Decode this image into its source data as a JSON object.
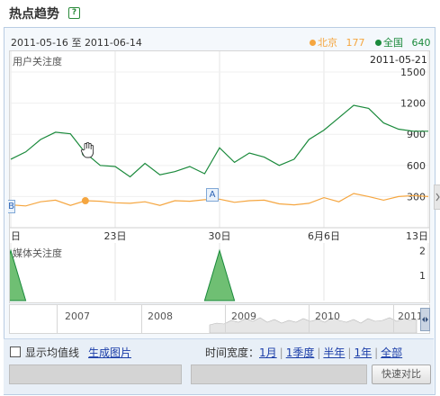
{
  "header": {
    "title": "热点趋势",
    "help_label": "?"
  },
  "range": {
    "start": "2011-05-16",
    "to": "至",
    "end": "2011-06-14"
  },
  "legend": {
    "beijing": {
      "name": "北京",
      "value": "177",
      "color": "#f5a640"
    },
    "national": {
      "name": "全国",
      "value": "640",
      "color": "#1b8a3c"
    }
  },
  "user_panel": {
    "label": "用户关注度",
    "hover_date": "2011-05-21"
  },
  "media_panel": {
    "label": "媒体关注度"
  },
  "annotations": {
    "a": "A",
    "b": "B"
  },
  "chart_data": [
    {
      "type": "line",
      "title": "用户关注度",
      "x_ticks": [
        "日",
        "23日",
        "30日",
        "6月6日",
        "13日"
      ],
      "y_ticks": [
        300,
        600,
        900,
        1200,
        1500
      ],
      "ylim": [
        0,
        1700
      ],
      "series": [
        {
          "name": "全国",
          "color": "#1b8a3c",
          "values": [
            660,
            730,
            850,
            920,
            905,
            720,
            600,
            590,
            490,
            620,
            510,
            540,
            590,
            520,
            770,
            630,
            720,
            680,
            600,
            660,
            850,
            940,
            1060,
            1180,
            1150,
            1010,
            950,
            930,
            930
          ]
        },
        {
          "name": "北京",
          "color": "#f5a640",
          "values": [
            220,
            210,
            250,
            265,
            215,
            260,
            255,
            240,
            235,
            250,
            215,
            260,
            255,
            270,
            275,
            245,
            260,
            265,
            230,
            220,
            235,
            290,
            250,
            330,
            300,
            265,
            300,
            310,
            300
          ]
        }
      ],
      "highlight": {
        "date": "2011-05-21",
        "全国": 720,
        "北京": 260
      }
    },
    {
      "type": "area",
      "title": "媒体关注度",
      "y_ticks": [
        1,
        2
      ],
      "ylim": [
        0,
        2.3
      ],
      "values": [
        2,
        0,
        0,
        0,
        0,
        0,
        0,
        0,
        0,
        0,
        0,
        0,
        0,
        0,
        2,
        0,
        0,
        0,
        0,
        0,
        0,
        0,
        0,
        0,
        0,
        0,
        0,
        0,
        0
      ]
    }
  ],
  "timeline": {
    "years": [
      "2007",
      "2008",
      "2009",
      "2010",
      "2011"
    ]
  },
  "controls": {
    "show_avg_label": "显示均值线",
    "gen_image_label": "生成图片",
    "time_width_label": "时间宽度：",
    "ranges": [
      "1月",
      "1季度",
      "半年",
      "1年",
      "全部"
    ],
    "compare_button": "快速对比"
  }
}
